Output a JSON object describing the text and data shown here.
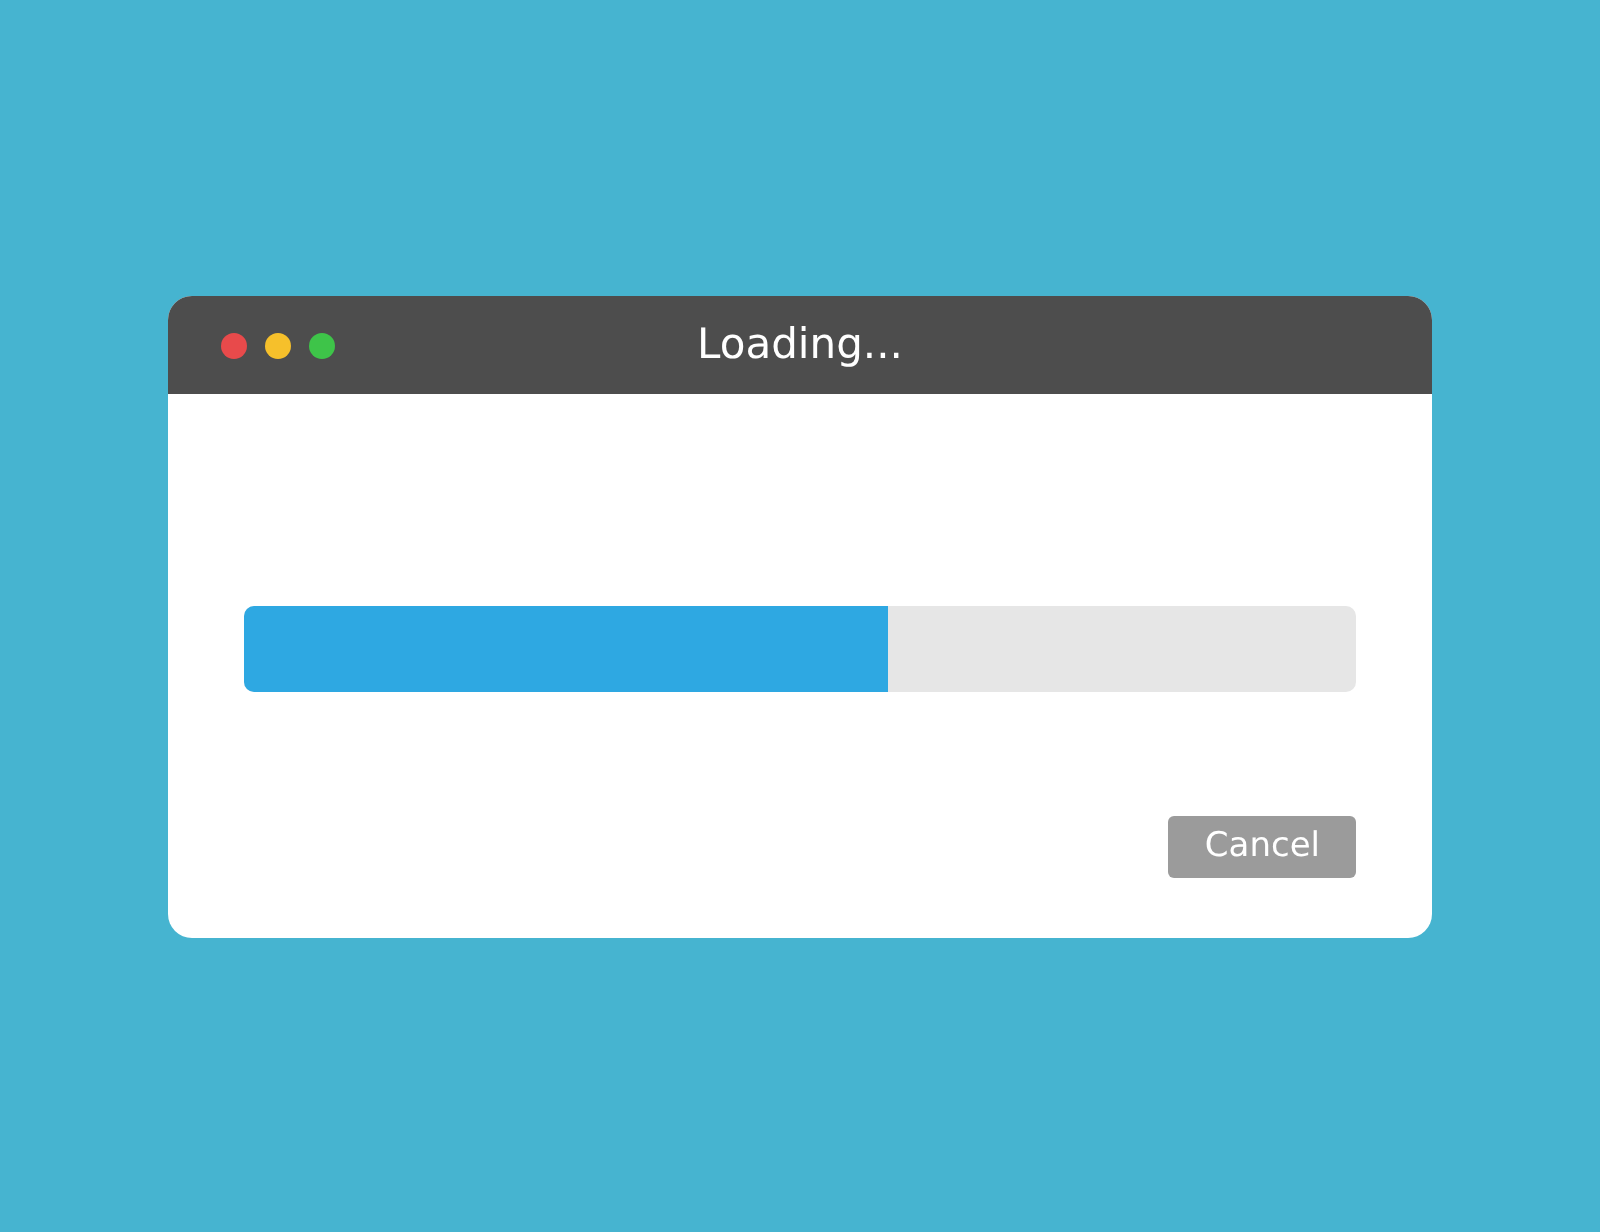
{
  "window": {
    "title": "Loading..."
  },
  "progress": {
    "level": 0.58
  },
  "buttons": [
    {
      "label": "Cancel",
      "kind": "secondary"
    }
  ]
}
